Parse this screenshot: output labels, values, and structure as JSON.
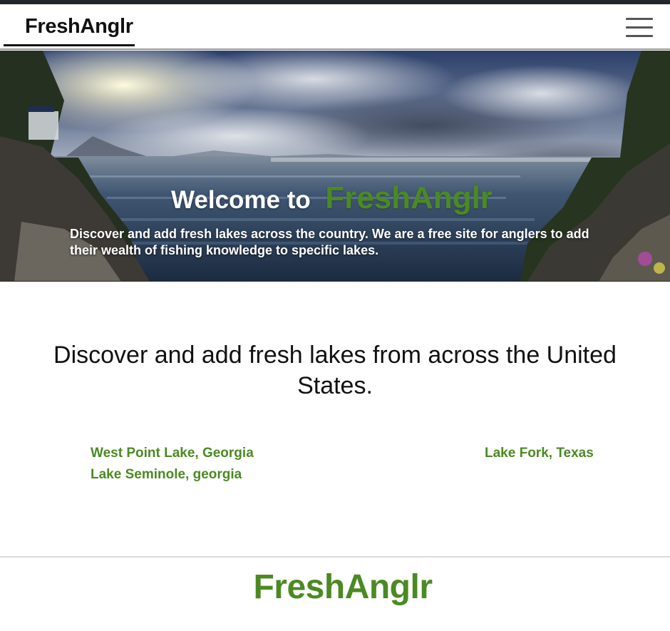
{
  "navbar": {
    "brand": "FreshAnglr",
    "menu_icon": "hamburger-menu-icon"
  },
  "hero": {
    "welcome": "Welcome to",
    "brand": "FreshAnglr",
    "description": "Discover and add fresh lakes across the country. We are a free site for anglers to add their wealth of fishing knowledge to specific lakes."
  },
  "main": {
    "heading": "Discover and add fresh lakes from across the United States.",
    "lakes": [
      {
        "label": "West Point Lake, Georgia"
      },
      {
        "label": "Lake Seminole, georgia"
      },
      {
        "label": "Lake Fork, Texas"
      }
    ]
  },
  "footer": {
    "brand": "FreshAnglr"
  },
  "colors": {
    "accent": "#4b8a22",
    "dark": "#111111",
    "topbar": "#222529"
  }
}
